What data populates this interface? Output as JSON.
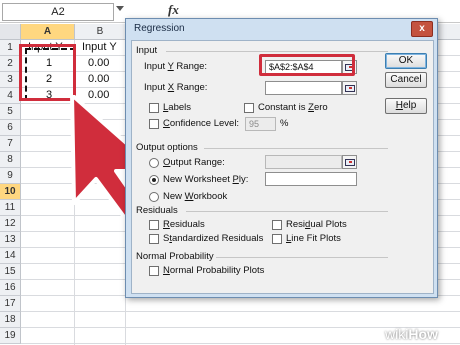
{
  "formula_bar": {
    "name_box": "A2",
    "fx": "fx"
  },
  "sheet": {
    "columns": [
      "A",
      "B"
    ],
    "rows": [
      "1",
      "2",
      "3",
      "4",
      "5",
      "6",
      "7",
      "8",
      "9",
      "10",
      "11",
      "12",
      "13",
      "14",
      "15",
      "16",
      "17",
      "18",
      "19"
    ],
    "selected_row": "10",
    "header_a": "Input Y",
    "header_b": "Input Y",
    "a_values": [
      "1",
      "2",
      "3"
    ],
    "b_values": [
      "0.00",
      "0.00",
      "0.00"
    ]
  },
  "dialog": {
    "title": "Regression",
    "close": "x",
    "input_group": "Input",
    "input_y_label_pre": "Input ",
    "input_y_label_u": "Y",
    "input_y_label_post": " Range:",
    "input_y_value": "$A$2:$A$4",
    "input_x_label_pre": "Input ",
    "input_x_label_u": "X",
    "input_x_label_post": " Range:",
    "input_x_value": "",
    "labels_u": "L",
    "labels_rest": "abels",
    "constant_pre": "Constant is ",
    "constant_u": "Z",
    "constant_post": "ero",
    "confidence_u": "C",
    "confidence_rest": "onfidence Level:",
    "confidence_value": "95",
    "percent": "%",
    "output_group": "Output options",
    "output_range_u": "O",
    "output_range_rest": "utput Range:",
    "new_ply_pre": "New Worksheet ",
    "new_ply_u": "P",
    "new_ply_post": "ly:",
    "new_workbook_pre": "New ",
    "new_workbook_u": "W",
    "new_workbook_post": "orkbook",
    "residuals_group": "Residuals",
    "residuals_u": "R",
    "residuals_rest": "esiduals",
    "std_residuals_pre": "S",
    "std_residuals_u": "t",
    "std_residuals_post": "andardized Residuals",
    "residual_plots_pre": "Resi",
    "residual_plots_u": "d",
    "residual_plots_post": "ual Plots",
    "line_fit_u": "L",
    "line_fit_rest": "ine Fit Plots",
    "normal_group": "Normal Probability",
    "normal_plots_u": "N",
    "normal_plots_rest": "ormal Probability Plots",
    "buttons": {
      "ok": "OK",
      "cancel": "Cancel",
      "help_u": "H",
      "help_rest": "elp"
    }
  },
  "watermark": {
    "w1": "wiki",
    "w2": "How"
  },
  "colors": {
    "accent_red": "#d02d3c",
    "dialog_frame": "#cfe0f1",
    "selected_header": "#ffd780"
  }
}
